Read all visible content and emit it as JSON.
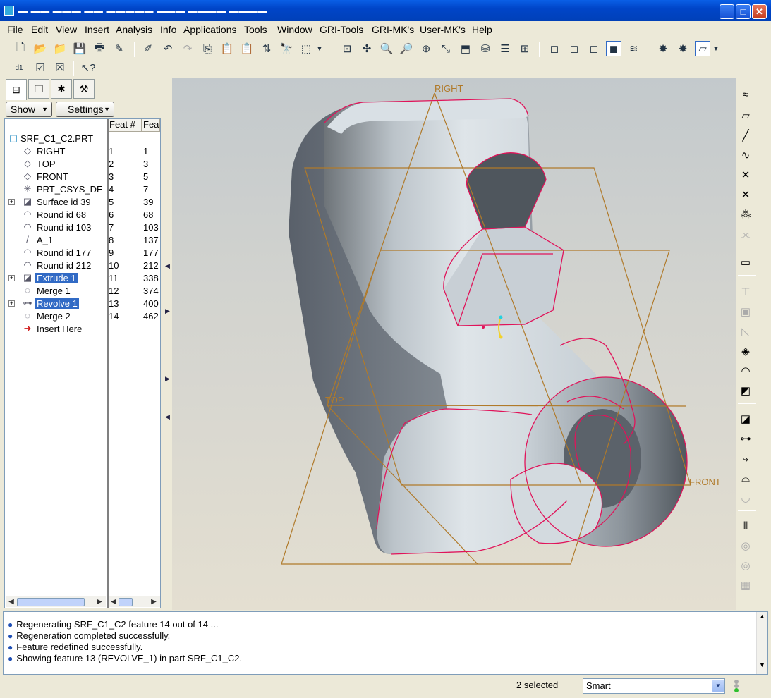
{
  "window": {
    "title": "▬ ▬▬ ▬▬▬ ▬▬ ▬▬▬▬▬ ▬▬▬ ▬▬▬▬ ▬▬▬▬",
    "minimize": "_",
    "maximize": "□",
    "close": "✕"
  },
  "menu": [
    "File",
    "Edit",
    "View",
    "Insert",
    "Analysis",
    "Info",
    "Applications",
    "Tools",
    "Window",
    "GRI-Tools",
    "GRI-MK's",
    "User-MK's",
    "Help"
  ],
  "toolbar1_icons": [
    "new-icon",
    "open-icon",
    "open-multiple-icon",
    "save-icon",
    "print-icon",
    "save-as-icon",
    "regenerate-icon",
    "undo-icon",
    "redo-icon",
    "copy-icon",
    "paste-icon",
    "paste-special-icon",
    "reorder-icon",
    "find-icon",
    "selection-box-icon",
    "repaint-icon",
    "spin-center-icon",
    "zoom-in-icon",
    "zoom-out-icon",
    "refit-icon",
    "orient-icon",
    "named-views-icon",
    "layers-icon",
    "view-manager-icon",
    "wireframe-icon",
    "hidden-line-icon",
    "no-hidden-icon",
    "shading-icon",
    "model-tree-icon",
    "datum-display-icon",
    "datum-planes-icon",
    "annotation-icon"
  ],
  "toolbar2_icons": [
    "ruler-icon",
    "check-box-icon",
    "close-box-icon",
    "context-help-icon"
  ],
  "nav": {
    "tabs": [
      "model-tree-tab",
      "layer-tab",
      "favorites-tab",
      "folder-tab"
    ],
    "show_label": "Show",
    "settings_label": "Settings",
    "col_feat_num": "Feat #",
    "col_feat_id": "Feat",
    "root_label": "SRF_C1_C2.PRT",
    "rows": [
      {
        "label": "RIGHT",
        "num": "1",
        "id": "1",
        "icon": "◇",
        "icon_name": "datum-plane-icon",
        "expand": "",
        "selected": false
      },
      {
        "label": "TOP",
        "num": "2",
        "id": "3",
        "icon": "◇",
        "icon_name": "datum-plane-icon",
        "expand": "",
        "selected": false
      },
      {
        "label": "FRONT",
        "num": "3",
        "id": "5",
        "icon": "◇",
        "icon_name": "datum-plane-icon",
        "expand": "",
        "selected": false
      },
      {
        "label": "PRT_CSYS_DE",
        "num": "4",
        "id": "7",
        "icon": "✳",
        "icon_name": "csys-icon",
        "expand": "",
        "selected": false
      },
      {
        "label": "Surface id 39",
        "num": "5",
        "id": "39",
        "icon": "◪",
        "icon_name": "surface-icon",
        "expand": "+",
        "selected": false
      },
      {
        "label": "Round id 68",
        "num": "6",
        "id": "68",
        "icon": "◠",
        "icon_name": "round-icon",
        "expand": "",
        "selected": false
      },
      {
        "label": "Round id 103",
        "num": "7",
        "id": "103",
        "icon": "◠",
        "icon_name": "round-icon",
        "expand": "",
        "selected": false
      },
      {
        "label": "A_1",
        "num": "8",
        "id": "137",
        "icon": "/",
        "icon_name": "datum-axis-icon",
        "expand": "",
        "selected": false
      },
      {
        "label": "Round id 177",
        "num": "9",
        "id": "177",
        "icon": "◠",
        "icon_name": "round-icon",
        "expand": "",
        "selected": false
      },
      {
        "label": "Round id 212",
        "num": "10",
        "id": "212",
        "icon": "◠",
        "icon_name": "round-icon",
        "expand": "",
        "selected": false
      },
      {
        "label": "Extrude 1",
        "num": "11",
        "id": "338",
        "icon": "◪",
        "icon_name": "extrude-icon",
        "expand": "+",
        "selected": true
      },
      {
        "label": "Merge 1",
        "num": "12",
        "id": "374",
        "icon": "◌",
        "icon_name": "merge-icon",
        "expand": "",
        "selected": false
      },
      {
        "label": "Revolve 1",
        "num": "13",
        "id": "400",
        "icon": "⊶",
        "icon_name": "revolve-icon",
        "expand": "+",
        "selected": true
      },
      {
        "label": "Merge 2",
        "num": "14",
        "id": "462",
        "icon": "◌",
        "icon_name": "merge-icon",
        "expand": "",
        "selected": false
      },
      {
        "label": "Insert Here",
        "num": "",
        "id": "",
        "icon": "➜",
        "icon_name": "insert-here-icon",
        "expand": "",
        "selected": false
      }
    ]
  },
  "viewport": {
    "plane_right": "RIGHT",
    "plane_top": "TOP",
    "plane_front": "FRONT"
  },
  "right_toolbar_icons": [
    "sketched-datum-curve-icon",
    "datum-plane-icon",
    "datum-axis-icon",
    "datum-curve-icon",
    "datum-point-icon",
    "datum-point-offset-icon",
    "datum-point-field-icon",
    "analysis-feature-icon",
    "annotation-feature-icon",
    "hole-icon",
    "shell-icon",
    "rib-icon",
    "draft-icon",
    "round-icon",
    "chamfer-icon",
    "extrude-icon",
    "revolve-icon",
    "sweep-icon",
    "boundary-blend-icon",
    "style-icon",
    "mirror-icon",
    "merge-icon",
    "trim-icon",
    "pattern-icon"
  ],
  "messages": [
    "Regenerating SRF_C1_C2 feature 14 out of 14 ...",
    "Regeneration completed successfully.",
    "Feature redefined successfully.",
    "Showing feature 13 (REVOLVE_1) in part SRF_C1_C2."
  ],
  "status": {
    "selected_count": "2 selected",
    "filter_value": "Smart"
  },
  "colors": {
    "title_blue": "#0045c8",
    "selection": "#316ac5",
    "datum_plane": "#b07a2a",
    "edge_highlight": "#e0145a"
  }
}
